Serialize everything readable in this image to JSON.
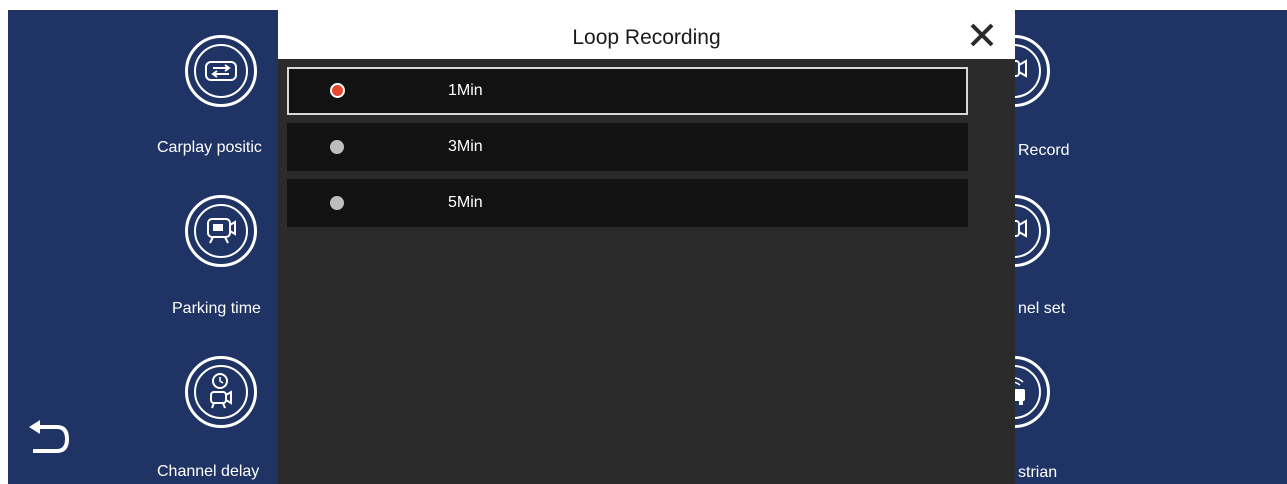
{
  "background": {
    "color": "#1f3465",
    "left_tiles": [
      {
        "label": "Carplay positic",
        "icon": "swap-arrows-icon"
      },
      {
        "label": "Parking time",
        "icon": "tv-camera-time-icon"
      },
      {
        "label": "Channel delay",
        "icon": "clock-camera-icon"
      }
    ],
    "right_tiles": [
      {
        "label": "Record",
        "icon": "video-camera-icon"
      },
      {
        "label": "nel set",
        "icon": "video-camera-icon"
      },
      {
        "label": "strian",
        "icon": "pedestrian-car-icon"
      }
    ],
    "back_icon": "back-arrow-icon"
  },
  "modal": {
    "title": "Loop Recording",
    "close_icon": "close-x-icon",
    "options": [
      {
        "label": "1Min",
        "selected": true
      },
      {
        "label": "3Min",
        "selected": false
      },
      {
        "label": "5Min",
        "selected": false
      }
    ],
    "accent_color": "#e8472e"
  }
}
